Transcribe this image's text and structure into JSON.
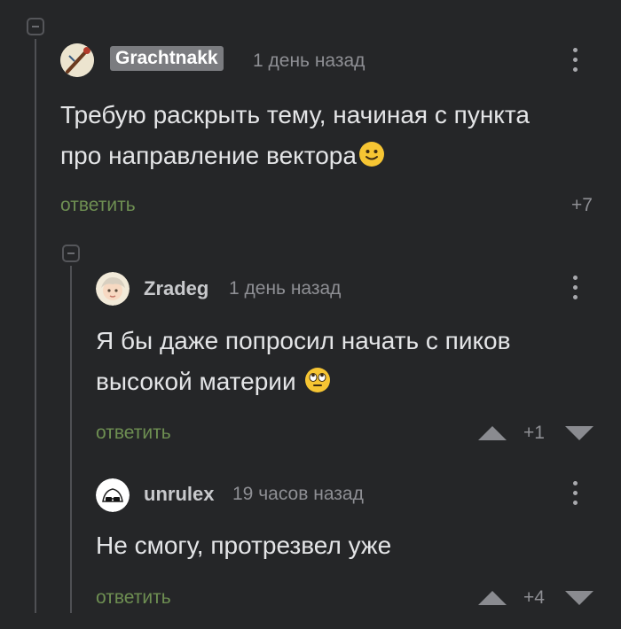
{
  "comments": [
    {
      "user": "Grachtnakk",
      "time": "1 день назад",
      "text_line1": "Требую раскрыть тему, начиная с пункта",
      "text_line2": "про направление вектора",
      "reply_label": "ответить",
      "rating": "+7"
    },
    {
      "user": "Zradeg",
      "time": "1 день назад",
      "text_line1": "Я бы даже попросил начать с пиков",
      "text_line2": "высокой материи",
      "reply_label": "ответить",
      "rating": "+1"
    },
    {
      "user": "unrulex",
      "time": "19 часов назад",
      "text_line1": "Не смогу, протрезвел уже",
      "reply_label": "ответить",
      "rating": "+4"
    }
  ],
  "colors": {
    "background": "#252628",
    "reply": "#6e8f52",
    "op_badge": "#7b7c80"
  },
  "icons": [
    "collapse-icon",
    "kebab-menu-icon",
    "upvote-icon",
    "downvote-icon",
    "slight-smile-emoji",
    "eye-roll-emoji"
  ]
}
